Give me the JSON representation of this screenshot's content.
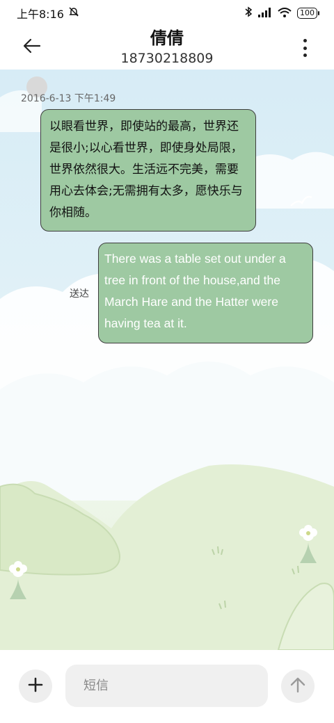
{
  "status_bar": {
    "time": "上午8:16",
    "battery": "100"
  },
  "header": {
    "contact_name": "倩倩",
    "contact_number": "18730218809"
  },
  "messages": [
    {
      "direction": "incoming",
      "timestamp": "2016-6-13 下午1:49",
      "text": "以眼看世界，即使站的最高，世界还是很小;以心看世界，即使身处局限，世界依然很大。生活远不完美，需要用心去体会;无需拥有太多，愿快乐与你相随。"
    },
    {
      "direction": "outgoing",
      "status": "送达",
      "text": "There was a table set out under a tree in front of the house,and the March Hare and the Hatter were having tea at it."
    }
  ],
  "input_bar": {
    "placeholder": "短信"
  },
  "colors": {
    "bubble": "#9ec9a2",
    "bubble_border": "#3d3d3d",
    "sky": "#d7ecf6",
    "grass": "#e7f2dc"
  },
  "icons": {
    "back": "arrow-left-icon",
    "more": "more-vertical-icon",
    "add": "plus-icon",
    "send": "arrow-up-icon"
  }
}
